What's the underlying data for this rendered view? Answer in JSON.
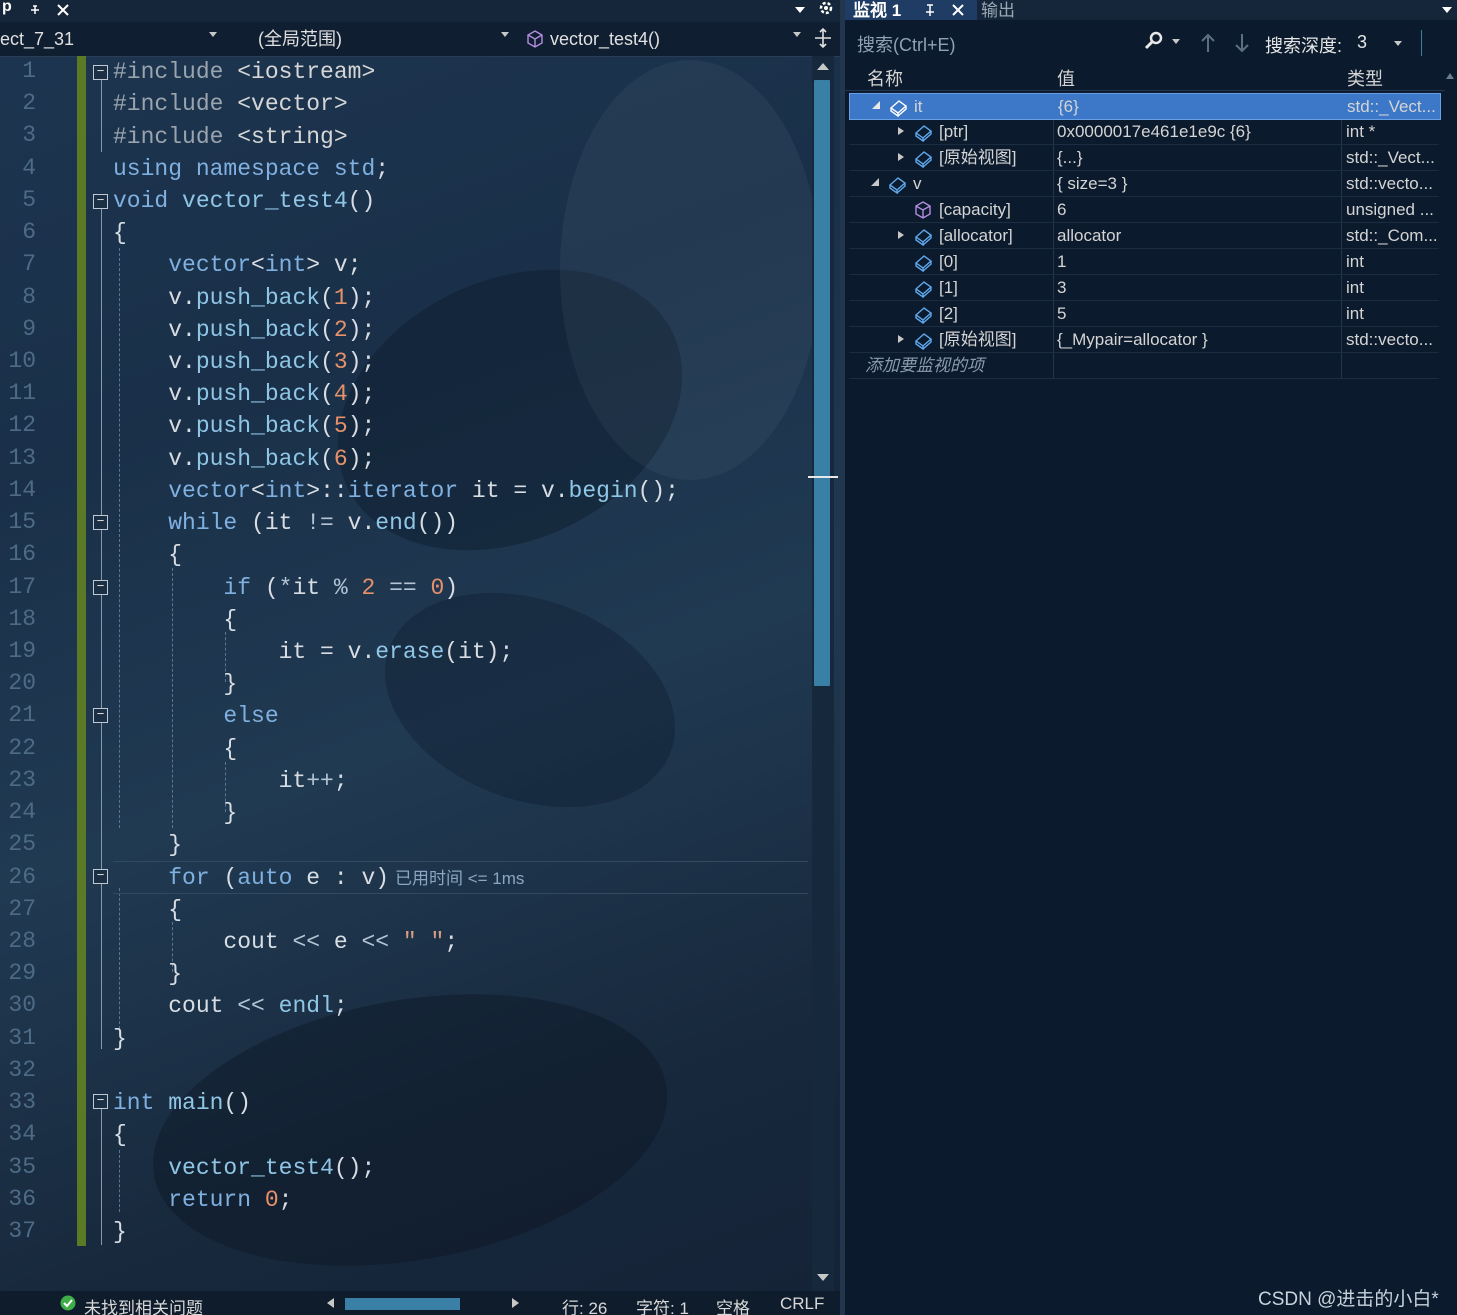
{
  "editor": {
    "tab_glyph": "p",
    "nav": {
      "project": "ect_7_31",
      "scope": "(全局范围)",
      "function": "vector_test4()"
    },
    "line_numbers": [
      "1",
      "2",
      "3",
      "4",
      "5",
      "6",
      "7",
      "8",
      "9",
      "10",
      "11",
      "12",
      "13",
      "14",
      "15",
      "16",
      "17",
      "18",
      "19",
      "20",
      "21",
      "22",
      "23",
      "24",
      "25",
      "26",
      "27",
      "28",
      "29",
      "30",
      "31",
      "32",
      "33",
      "34",
      "35",
      "36",
      "37"
    ],
    "perf_tip": "已用时间 <= 1ms",
    "status": {
      "issues": "未找到相关问题",
      "line": "行: 26",
      "char": "字符: 1",
      "space": "空格",
      "eol": "CRLF"
    }
  },
  "watch": {
    "tab_active": "监视 1",
    "tab_other": "输出",
    "search_placeholder": "搜索(Ctrl+E)",
    "depth_label": "搜索深度:",
    "depth_value": "3",
    "columns": {
      "name": "名称",
      "value": "值",
      "type": "类型"
    },
    "rows": [
      {
        "name": "it",
        "value": "{6}",
        "type": "std::_Vect..."
      },
      {
        "name": "[ptr]",
        "value": "0x0000017e461e1e9c {6}",
        "type": "int *"
      },
      {
        "name": "[原始视图]",
        "value": "{...}",
        "type": "std::_Vect..."
      },
      {
        "name": "v",
        "value": "{ size=3 }",
        "type": "std::vecto..."
      },
      {
        "name": "[capacity]",
        "value": "6",
        "type": "unsigned ..."
      },
      {
        "name": "[allocator]",
        "value": "allocator",
        "type": "std::_Com..."
      },
      {
        "name": "[0]",
        "value": "1",
        "type": "int"
      },
      {
        "name": "[1]",
        "value": "3",
        "type": "int"
      },
      {
        "name": "[2]",
        "value": "5",
        "type": "int"
      },
      {
        "name": "[原始视图]",
        "value": "{_Mypair=allocator }",
        "type": "std::vecto..."
      }
    ],
    "add_item": "添加要监视的项"
  },
  "watermark": "CSDN @进击的小白*",
  "colors": {
    "selected_row": "#3c78c7",
    "change_bar": "#5b7a26",
    "scroll_thumb": "#3a7fa6"
  }
}
